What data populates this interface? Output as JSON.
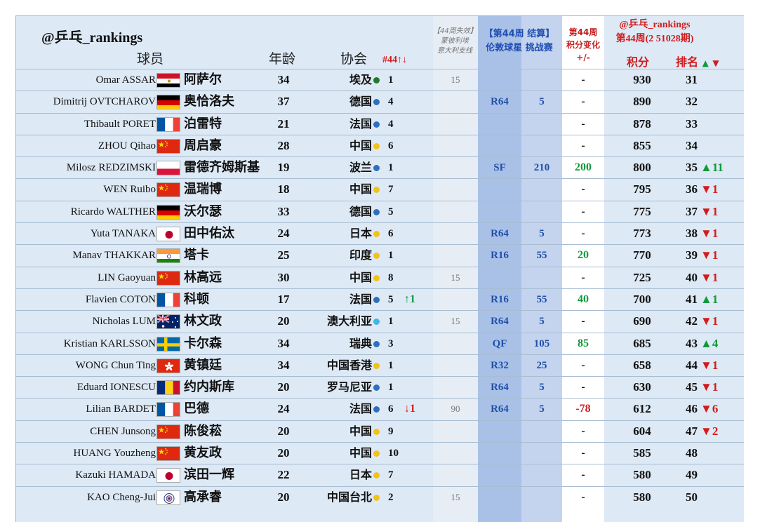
{
  "header": {
    "brand": "@乒乓_rankings",
    "player_col": "球员",
    "age_col": "年龄",
    "assoc_col": "协会",
    "week_col": "#44↑↓",
    "lost_col_line1": "【44周失效】",
    "lost_col_line2": "蒙彼利埃",
    "lost_col_line3": "意大利支线",
    "event_col_line1": "【第44周 结算】",
    "event_col_line2": "伦敦球星 挑战赛",
    "change_col_line1": "第44周",
    "change_col_line2": "积分变化",
    "change_col_line3": "+/-",
    "rankings_title_line1": "@乒乓_rankings",
    "rankings_title_line2": "第44周(2 51028期)",
    "points_col": "积分",
    "rank_col": "排名",
    "rank_up_glyph": "▲",
    "rank_down_glyph": "▼"
  },
  "colors": {
    "dot_blue": "#2f6fbf",
    "dot_yellow": "#f2c21a",
    "dot_lightblue": "#41b6e6",
    "up": "#0f9a3c",
    "down": "#d21c1c"
  },
  "rows": [
    {
      "en": "Omar ASSAR",
      "flag": "egypt",
      "cn": "阿萨尔",
      "age": "34",
      "assoc": "埃及",
      "dot": "green",
      "count": "1",
      "arrow": "",
      "lost": "15",
      "event": "",
      "prize": "",
      "change": "-",
      "points": "930",
      "rank": "31",
      "move": ""
    },
    {
      "en": "Dimitrij OVTCHAROV",
      "flag": "germany",
      "cn": "奥恰洛夫",
      "age": "37",
      "assoc": "德国",
      "dot": "blue",
      "count": "4",
      "arrow": "",
      "lost": "",
      "event": "R64",
      "prize": "5",
      "change": "-",
      "points": "890",
      "rank": "32",
      "move": ""
    },
    {
      "en": "Thibault PORET",
      "flag": "france",
      "cn": "泊雷特",
      "age": "21",
      "assoc": "法国",
      "dot": "blue",
      "count": "4",
      "arrow": "",
      "lost": "",
      "event": "",
      "prize": "",
      "change": "-",
      "points": "878",
      "rank": "33",
      "move": ""
    },
    {
      "en": "ZHOU Qihao",
      "flag": "china",
      "cn": "周启豪",
      "age": "28",
      "assoc": "中国",
      "dot": "yellow",
      "count": "6",
      "arrow": "",
      "lost": "",
      "event": "",
      "prize": "",
      "change": "-",
      "points": "855",
      "rank": "34",
      "move": ""
    },
    {
      "en": "Milosz REDZIMSKI",
      "flag": "poland",
      "cn": "雷德齐姆斯基",
      "age": "19",
      "assoc": "波兰",
      "dot": "blue",
      "count": "1",
      "arrow": "",
      "lost": "",
      "event": "SF",
      "prize": "210",
      "change": "200",
      "points": "800",
      "rank": "35",
      "move": "▲11"
    },
    {
      "en": "WEN Ruibo",
      "flag": "china",
      "cn": "温瑞博",
      "age": "18",
      "assoc": "中国",
      "dot": "yellow",
      "count": "7",
      "arrow": "",
      "lost": "",
      "event": "",
      "prize": "",
      "change": "-",
      "points": "795",
      "rank": "36",
      "move": "▼1"
    },
    {
      "en": "Ricardo WALTHER",
      "flag": "germany",
      "cn": "沃尔瑟",
      "age": "33",
      "assoc": "德国",
      "dot": "blue",
      "count": "5",
      "arrow": "",
      "lost": "",
      "event": "",
      "prize": "",
      "change": "-",
      "points": "775",
      "rank": "37",
      "move": "▼1"
    },
    {
      "en": "Yuta TANAKA",
      "flag": "japan",
      "cn": "田中佑汰",
      "age": "24",
      "assoc": "日本",
      "dot": "yellow",
      "count": "6",
      "arrow": "",
      "lost": "",
      "event": "R64",
      "prize": "5",
      "change": "-",
      "points": "773",
      "rank": "38",
      "move": "▼1"
    },
    {
      "en": "Manav THAKKAR",
      "flag": "india",
      "cn": "塔卡",
      "age": "25",
      "assoc": "印度",
      "dot": "yellow",
      "count": "1",
      "arrow": "",
      "lost": "",
      "event": "R16",
      "prize": "55",
      "change": "20",
      "points": "770",
      "rank": "39",
      "move": "▼1"
    },
    {
      "en": "LIN Gaoyuan",
      "flag": "china",
      "cn": "林高远",
      "age": "30",
      "assoc": "中国",
      "dot": "yellow",
      "count": "8",
      "arrow": "",
      "lost": "15",
      "event": "",
      "prize": "",
      "change": "-",
      "points": "725",
      "rank": "40",
      "move": "▼1"
    },
    {
      "en": "Flavien COTON",
      "flag": "france",
      "cn": "科顿",
      "age": "17",
      "assoc": "法国",
      "dot": "blue",
      "count": "5",
      "arrow": "↑1",
      "lost": "",
      "event": "R16",
      "prize": "55",
      "change": "40",
      "points": "700",
      "rank": "41",
      "move": "▲1"
    },
    {
      "en": "Nicholas LUM",
      "flag": "australia",
      "cn": "林文政",
      "age": "20",
      "assoc": "澳大利亚",
      "dot": "lightblue",
      "count": "1",
      "arrow": "",
      "lost": "15",
      "event": "R64",
      "prize": "5",
      "change": "-",
      "points": "690",
      "rank": "42",
      "move": "▼1"
    },
    {
      "en": "Kristian KARLSSON",
      "flag": "sweden",
      "cn": "卡尔森",
      "age": "34",
      "assoc": "瑞典",
      "dot": "blue",
      "count": "3",
      "arrow": "",
      "lost": "",
      "event": "QF",
      "prize": "105",
      "change": "85",
      "points": "685",
      "rank": "43",
      "move": "▲4"
    },
    {
      "en": "WONG Chun Ting",
      "flag": "hongkong",
      "cn": "黄镇廷",
      "age": "34",
      "assoc": "中国香港",
      "dot": "yellow",
      "count": "1",
      "arrow": "",
      "lost": "",
      "event": "R32",
      "prize": "25",
      "change": "-",
      "points": "658",
      "rank": "44",
      "move": "▼1"
    },
    {
      "en": "Eduard IONESCU",
      "flag": "romania",
      "cn": "约内斯库",
      "age": "20",
      "assoc": "罗马尼亚",
      "dot": "blue",
      "count": "1",
      "arrow": "",
      "lost": "",
      "event": "R64",
      "prize": "5",
      "change": "-",
      "points": "630",
      "rank": "45",
      "move": "▼1"
    },
    {
      "en": "Lilian BARDET",
      "flag": "france",
      "cn": "巴德",
      "age": "24",
      "assoc": "法国",
      "dot": "blue",
      "count": "6",
      "arrow": "↓1",
      "lost": "90",
      "event": "R64",
      "prize": "5",
      "change": "-78",
      "points": "612",
      "rank": "46",
      "move": "▼6"
    },
    {
      "en": "CHEN Junsong",
      "flag": "china",
      "cn": "陈俊菘",
      "age": "20",
      "assoc": "中国",
      "dot": "yellow",
      "count": "9",
      "arrow": "",
      "lost": "",
      "event": "",
      "prize": "",
      "change": "-",
      "points": "604",
      "rank": "47",
      "move": "▼2"
    },
    {
      "en": "HUANG Youzheng",
      "flag": "china",
      "cn": "黄友政",
      "age": "20",
      "assoc": "中国",
      "dot": "yellow",
      "count": "10",
      "arrow": "",
      "lost": "",
      "event": "",
      "prize": "",
      "change": "-",
      "points": "585",
      "rank": "48",
      "move": ""
    },
    {
      "en": "Kazuki HAMADA",
      "flag": "japan",
      "cn": "滨田一辉",
      "age": "22",
      "assoc": "日本",
      "dot": "yellow",
      "count": "7",
      "arrow": "",
      "lost": "",
      "event": "",
      "prize": "",
      "change": "-",
      "points": "580",
      "rank": "49",
      "move": ""
    },
    {
      "en": "KAO Cheng-Jui",
      "flag": "tpe",
      "cn": "高承睿",
      "age": "20",
      "assoc": "中国台北",
      "dot": "yellow",
      "count": "2",
      "arrow": "",
      "lost": "15",
      "event": "",
      "prize": "",
      "change": "-",
      "points": "580",
      "rank": "50",
      "move": ""
    }
  ]
}
